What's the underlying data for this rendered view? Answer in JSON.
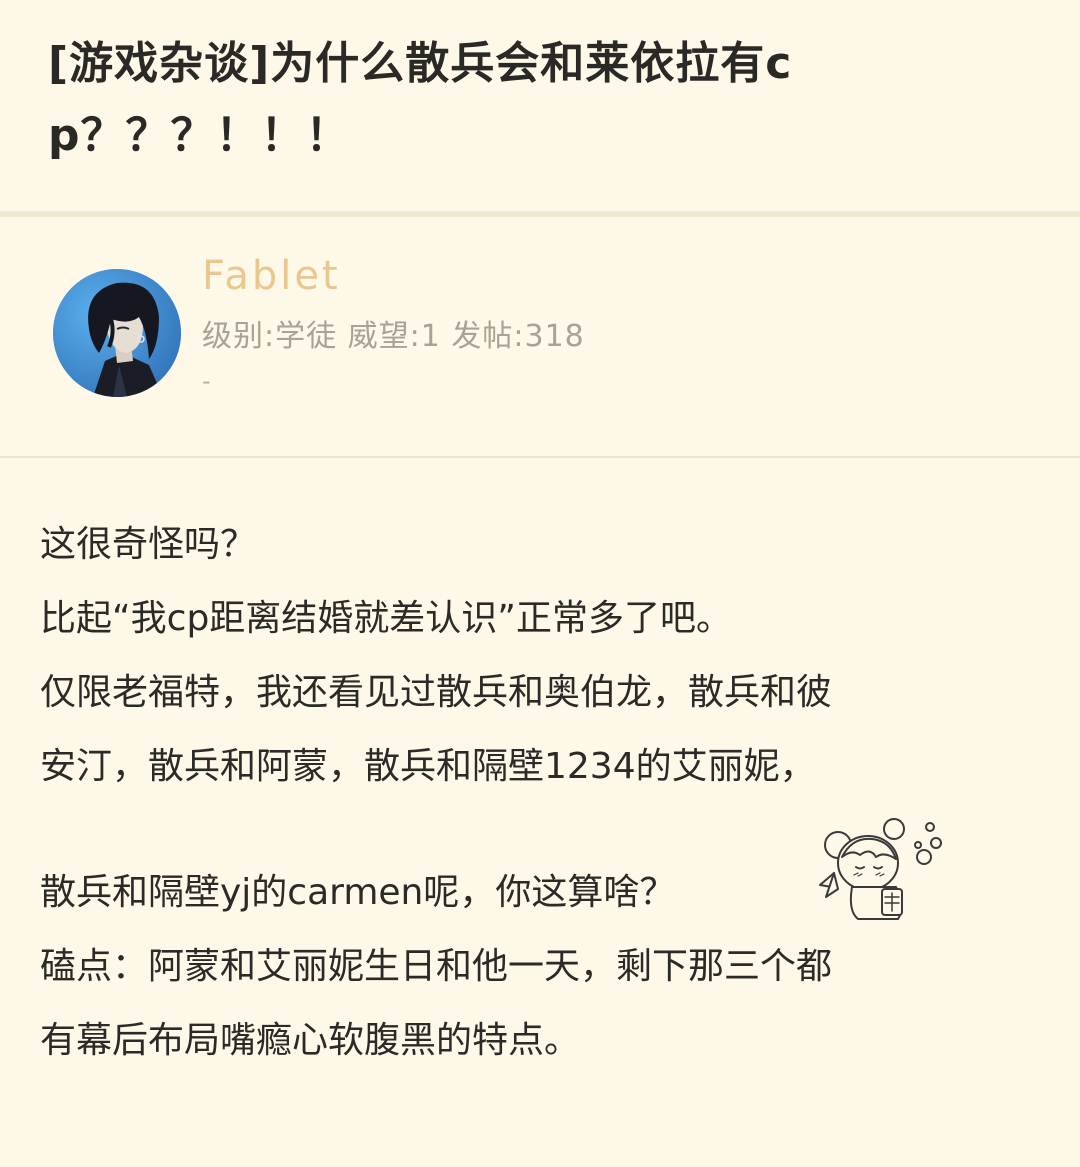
{
  "post": {
    "title_line1": "[游戏杂谈]为什么散兵会和莱依拉有c",
    "title_line2": "p？？？！！！"
  },
  "author": {
    "name": "Fablet",
    "stats": "级别:学徒 威望:1 发帖:318",
    "signature": "-",
    "avatar_icon": "anime-avatar-icon"
  },
  "body": {
    "lines": [
      "这很奇怪吗？",
      "比起“我cp距离结婚就差认识”正常多了吧。",
      "仅限老福特，我还看见过散兵和奥伯龙，散兵和彼",
      "安汀，散兵和阿蒙，散兵和隔壁1234的艾丽妮，",
      "散兵和隔壁yj的carmen呢，你这算啥？",
      "磕点：阿蒙和艾丽妮生日和他一天，剩下那三个都",
      "有幕后布局嘴瘾心软腹黑的特点。"
    ],
    "sticker_icon": "chibi-sticker-icon"
  },
  "colors": {
    "background": "#fdf8e7",
    "username": "#e9c890",
    "meta": "#a7a293",
    "text": "#2c2a26"
  }
}
